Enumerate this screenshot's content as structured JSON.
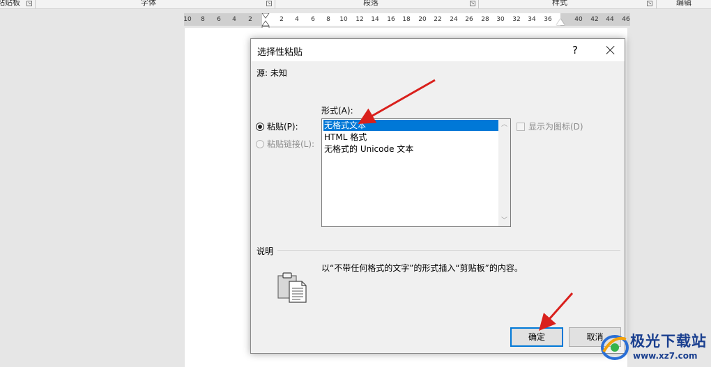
{
  "ribbon": {
    "groups": [
      "粘贴板",
      "字体",
      "段落",
      "样式",
      "编辑"
    ],
    "clipboard_label": "粘贴板",
    "font_label": "字体",
    "paragraph_label": "段落",
    "styles_label": "样式",
    "editing_label": "编辑"
  },
  "ruler": {
    "ticks": [
      "10",
      "8",
      "6",
      "4",
      "2",
      "2",
      "4",
      "6",
      "8",
      "10",
      "12",
      "14",
      "16",
      "18",
      "20",
      "22",
      "24",
      "26",
      "28",
      "30",
      "32",
      "34",
      "36",
      "40",
      "42",
      "44",
      "46"
    ]
  },
  "dialog": {
    "title": "选择性粘贴",
    "help": "?",
    "source": "源: 未知",
    "format_label": "形式(A):",
    "paste_label": "粘贴(P):",
    "paste_link_label": "粘贴链接(L):",
    "display_as_icon_label": "显示为图标(D)",
    "formats": [
      "无格式文本",
      "HTML 格式",
      "无格式的 Unicode 文本"
    ],
    "selected_format": "无格式文本",
    "description_heading": "说明",
    "description_text": "以“不带任何格式的文字”的形式插入“剪贴板”的内容。",
    "ok_label": "确定",
    "cancel_label": "取消"
  },
  "watermark": {
    "brand": "极光下载站",
    "url": "www.xz7.com"
  },
  "colors": {
    "accent": "#0078d7",
    "annotation_arrow": "#d9201c"
  }
}
